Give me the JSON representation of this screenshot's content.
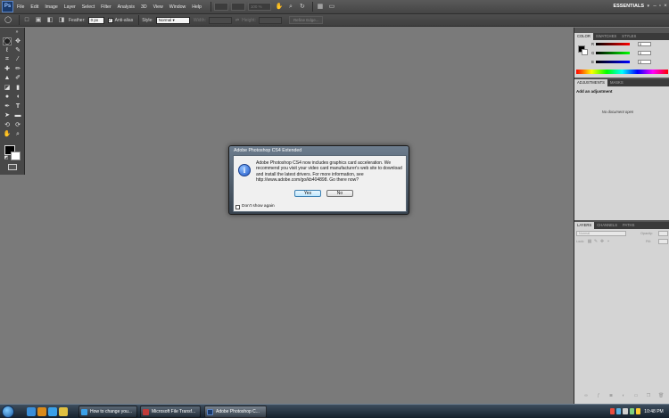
{
  "app": {
    "logo": "Ps",
    "menu": [
      "File",
      "Edit",
      "Image",
      "Layer",
      "Select",
      "Filter",
      "Analysis",
      "3D",
      "View",
      "Window",
      "Help"
    ],
    "zoom": "100 %",
    "workspace": "ESSENTIALS"
  },
  "options_bar": {
    "feather_label": "Feather:",
    "feather_value": "0 px",
    "antialias_label": "Anti-alias",
    "style_label": "Style:",
    "style_value": "Normal",
    "width_label": "Width:",
    "height_label": "Height:",
    "refine_edge": "Refine Edge..."
  },
  "panels": {
    "color_tabs": [
      "COLOR",
      "SWATCHES",
      "STYLES"
    ],
    "rgb": [
      {
        "channel": "R",
        "value": "0"
      },
      {
        "channel": "G",
        "value": "0"
      },
      {
        "channel": "B",
        "value": "0"
      }
    ],
    "adjustment_tabs": [
      "ADJUSTMENTS",
      "MASKS"
    ],
    "adjustments_title": "Add an adjustment",
    "no_document": "No document open",
    "layers_tabs": [
      "LAYERS",
      "CHANNELS",
      "PATHS"
    ],
    "blend_mode": "Normal",
    "opacity_label": "Opacity:",
    "lock_label": "Lock:",
    "fill_label": "Fill:"
  },
  "dialog": {
    "title": "Adobe Photoshop CS4 Extended",
    "message": "Adobe Photoshop CS4 now includes graphics card acceleration. We recommend you visit your video card manufacturer's web site to download and install the latest drivers. For more information, see http://www.adobe.com/go/kb404898. Go there now?",
    "yes": "Yes",
    "no": "No",
    "dont_show": "Don't show again"
  },
  "taskbar": {
    "tasks": [
      {
        "label": "How to change you..."
      },
      {
        "label": "Microsoft File Transf..."
      },
      {
        "label": "Adobe Photoshop C..."
      }
    ],
    "clock": "10:48 PM"
  },
  "colors": {
    "canvas": "#7a7a7a",
    "panel_bg": "#d4d4d4",
    "accent": "#1f57c8"
  }
}
